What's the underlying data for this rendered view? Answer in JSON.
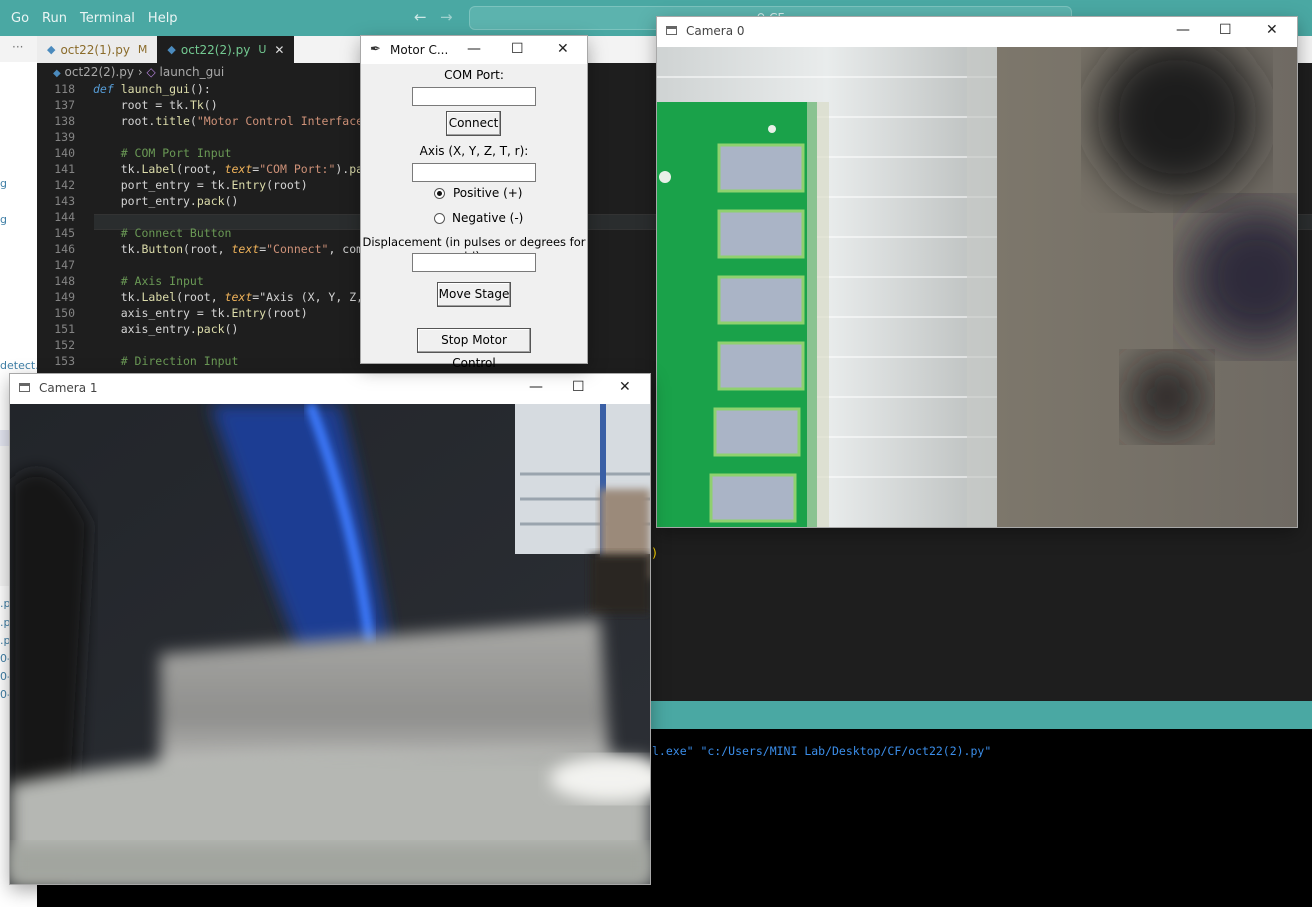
{
  "vscode": {
    "menu": [
      "Go",
      "Run",
      "Terminal",
      "Help"
    ],
    "search_text": "CF",
    "tabs": [
      {
        "label": "oct22(1).py",
        "status": "M"
      },
      {
        "label": "oct22(2).py",
        "status": "U"
      }
    ],
    "breadcrumb": {
      "file": "oct22(2).py",
      "symbol": "launch_gui"
    },
    "explorer_fragments": [
      "g",
      "g",
      "detect...",
      ".p",
      ".p",
      ".p",
      "0-",
      "0-",
      "0-"
    ],
    "terminal_text": "l.exe\" \"c:/Users/MINI Lab/Desktop/CF/oct22(2).py\""
  },
  "code_lines": [
    {
      "n": "118",
      "t": "def launch_gui():"
    },
    {
      "n": "137",
      "t": "    root = tk.Tk()"
    },
    {
      "n": "138",
      "t": "    root.title(\"Motor Control Interface\")"
    },
    {
      "n": "139",
      "t": ""
    },
    {
      "n": "140",
      "t": "    # COM Port Input"
    },
    {
      "n": "141",
      "t": "    tk.Label(root, text=\"COM Port:\").pack("
    },
    {
      "n": "142",
      "t": "    port_entry = tk.Entry(root)"
    },
    {
      "n": "143",
      "t": "    port_entry.pack()"
    },
    {
      "n": "144",
      "t": ""
    },
    {
      "n": "145",
      "t": "    # Connect Button"
    },
    {
      "n": "146",
      "t": "    tk.Button(root, text=\"Connect\", comman"
    },
    {
      "n": "147",
      "t": ""
    },
    {
      "n": "148",
      "t": "    # Axis Input"
    },
    {
      "n": "149",
      "t": "    tk.Label(root, text=\"Axis (X, Y, Z, T,"
    },
    {
      "n": "150",
      "t": "    axis_entry = tk.Entry(root)"
    },
    {
      "n": "151",
      "t": "    axis_entry.pack()"
    },
    {
      "n": "152",
      "t": ""
    },
    {
      "n": "153",
      "t": "    # Direction Input"
    }
  ],
  "motor_window": {
    "title": "Motor C...",
    "com_port_label": "COM Port:",
    "com_port_value": "",
    "connect_label": "Connect",
    "axis_label": "Axis (X, Y, Z, T, r):",
    "axis_value": "",
    "positive_label": "Positive (+)",
    "negative_label": "Negative (-)",
    "selected_direction": "positive",
    "displacement_label": "Displacement (in pulses or degrees for 'r'):",
    "displacement_value": "",
    "move_label": "Move Stage",
    "stop_label": "Stop Motor Control"
  },
  "camera0": {
    "title": "Camera 0"
  },
  "camera1": {
    "title": "Camera 1"
  },
  "window_buttons": {
    "minimize": "—",
    "maximize": "☐",
    "close": "✕"
  },
  "colors": {
    "titlebar": "#4aa8a3",
    "editor_bg": "#1e1e1e",
    "terminal_bg": "#000000",
    "dialog_bg": "#f0f0f0"
  }
}
